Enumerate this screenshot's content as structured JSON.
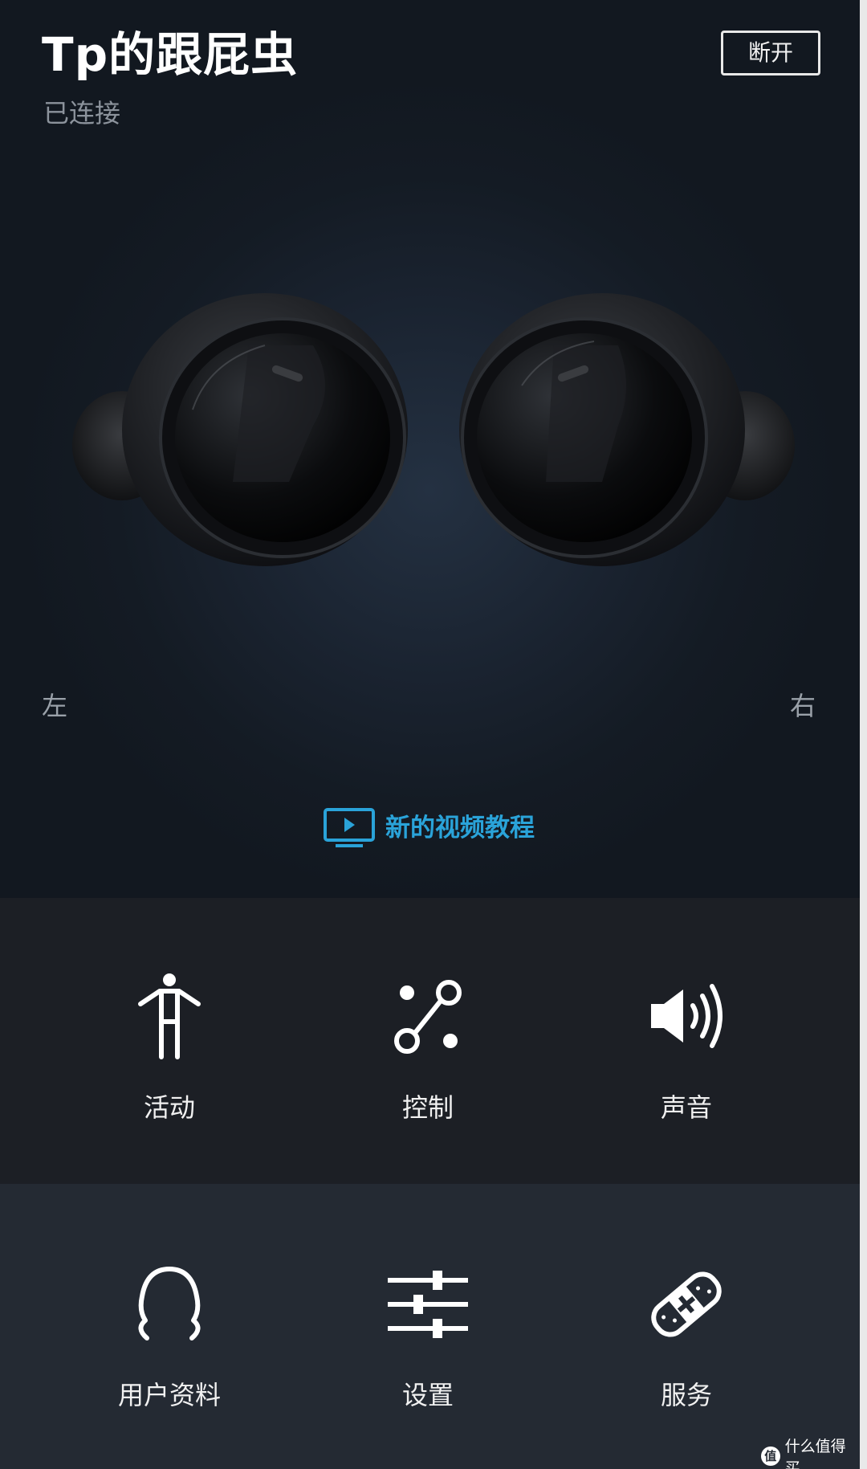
{
  "header": {
    "device_name": "Tp的跟屁虫",
    "status": "已连接",
    "disconnect_label": "断开"
  },
  "earbuds": {
    "left_label": "左",
    "right_label": "右"
  },
  "tutorial": {
    "label": "新的视频教程",
    "icon": "video-play-icon",
    "color": "#2aa3d9"
  },
  "menu": {
    "items": [
      {
        "label": "活动",
        "icon": "person-activity-icon"
      },
      {
        "label": "控制",
        "icon": "control-nodes-icon"
      },
      {
        "label": "声音",
        "icon": "speaker-volume-icon"
      },
      {
        "label": "用户资料",
        "icon": "user-profile-icon"
      },
      {
        "label": "设置",
        "icon": "sliders-settings-icon"
      },
      {
        "label": "服务",
        "icon": "bandage-service-icon"
      }
    ]
  },
  "watermark": {
    "icon_glyph": "值",
    "text": "什么值得买"
  },
  "colors": {
    "background": "#161b22",
    "accent": "#2aa3d9",
    "menu_row_1": "#1c1f25",
    "menu_row_2": "#242a33"
  }
}
